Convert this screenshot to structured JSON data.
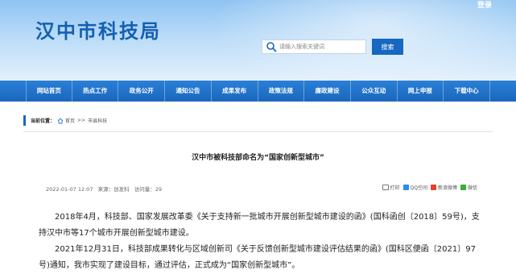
{
  "header": {
    "login_label": "登录",
    "site_title": "汉中市科技局",
    "search_placeholder": "请输入搜索关键词",
    "search_button_label": "搜索"
  },
  "nav": {
    "items": [
      "网站首页",
      "热点工作",
      "政务公开",
      "通知公告",
      "成果发布",
      "政策法规",
      "廉政建设",
      "公众互动",
      "网上申报",
      "下载中心"
    ]
  },
  "breadcrumb": {
    "label": "当前位置：",
    "home": "首页",
    "separator": ">>",
    "current": "市县科技"
  },
  "article": {
    "title": "汉中市被科技部命名为“国家创新型城市”",
    "date": "2022-01-07 12:07",
    "source": "来源：创发科",
    "visits": "访问量：29",
    "paragraphs": [
      "2018年4月，科技部、国家发展改革委《关于支持新一批城市开展创新型城市建设的函》(国科函创〔2018〕59号)，支持汉中市等17个城市开展创新型城市建设。",
      "2021年12月31日，科技部成果转化与区域创新司《关于反馈创新型城市建设评估结果的函》(国科区便函〔2021〕97号)通知，我市实现了建设目标，通过评估，正式成为“国家创新型城市”。"
    ]
  },
  "share": {
    "print_label": "打印",
    "qq_label": "QQ空间",
    "weibo_label": "新浪微博",
    "wechat_label": "微信"
  },
  "colors": {
    "brand_blue": "#1668c1",
    "nav_blue": "#1967bd",
    "title_blue": "#1560b0"
  }
}
